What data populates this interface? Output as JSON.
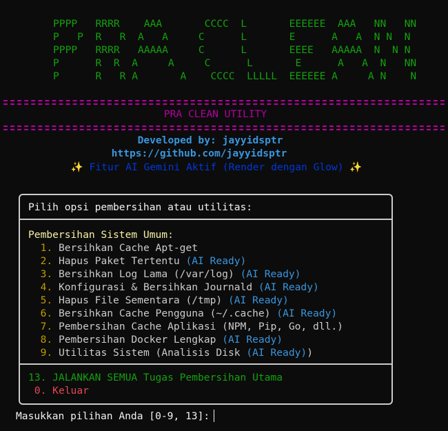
{
  "banner": {
    "ascii_lines": [
      "PPPP   RRRR    AAA       CCCC  L       EEEEEE  AAA   NN   NN",
      "P   P  R   R  A   A     C      L       E      A   A  N N  N",
      "PPPP   RRRR   AAAAA     C      L       EEEE   AAAAA  N  N N",
      "P      R  R  A     A     C      L       E      A   A  N   NN",
      "P      R   R A       A    CCCC  LLLLL  EEEEEE A     A N    N"
    ],
    "title": "PRA CLEAN UTILITY"
  },
  "developer": {
    "line": "Developed by: jayyidsptr",
    "url": "https://github.com/jayyidsptr"
  },
  "gemini": {
    "spark_icon": "✨",
    "text": "Fitur AI Gemini Aktif (Render dengan Glow)"
  },
  "menu": {
    "header": "Pilih opsi pembersihan atau utilitas:",
    "section_title": "Pembersihan Sistem Umum:",
    "items": [
      {
        "num": "1.",
        "label": "Bersihkan Cache Apt-get",
        "ai": ""
      },
      {
        "num": "2.",
        "label": "Hapus Paket Tertentu",
        "ai": "(AI Ready)"
      },
      {
        "num": "3.",
        "label": "Bersihkan Log Lama (/var/log)",
        "ai": "(AI Ready)"
      },
      {
        "num": "4.",
        "label": "Konfigurasi & Bersihkan Journald",
        "ai": "(AI Ready)"
      },
      {
        "num": "5.",
        "label": "Hapus File Sementara (/tmp)",
        "ai": "(AI Ready)"
      },
      {
        "num": "6.",
        "label": "Bersihkan Cache Pengguna (~/.cache)",
        "ai": "(AI Ready)"
      },
      {
        "num": "7.",
        "label": "Pembersihan Cache Aplikasi (NPM, Pip, Go, dll.)",
        "ai": ""
      },
      {
        "num": "8.",
        "label": "Pembersihan Docker Lengkap",
        "ai": "(AI Ready)"
      },
      {
        "num": "9.",
        "label": "Utilitas Sistem (Analisis Disk",
        "ai": "(AI Ready)",
        "tail": ")"
      }
    ],
    "run_all": "13. JALANKAN SEMUA Tugas Pembersihan Utama",
    "exit_num": "0.",
    "exit_label": "Keluar"
  },
  "prompt": {
    "text": "Masukkan pilihan Anda [0-9, 13]:"
  },
  "colors": {
    "background": "#0c0c0c",
    "banner_green": "#13a10e",
    "magenta": "#b4009e",
    "blue": "#3a96dd",
    "dark_blue": "#0037da",
    "yellow": "#f9f1a5",
    "number": "#c19c00",
    "red": "#e74856"
  }
}
